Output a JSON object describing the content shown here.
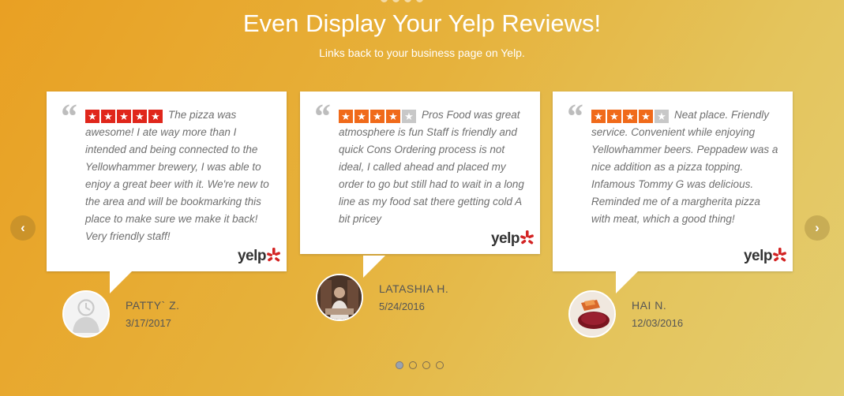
{
  "header": {
    "title": "Even Display Your Yelp Reviews!",
    "subtitle": "Links back to your business page on Yelp."
  },
  "reviews": [
    {
      "rating": 5,
      "star_color": "#e0261b",
      "text": "The pizza was awesome! I ate way more than I intended and being connected to the Yellowhammer brewery, I was able to enjoy a great beer with it. We're new to the area and will be bookmarking this place to make sure we make it back! Very friendly staff!",
      "author": "PATTY` Z.",
      "date": "3/17/2017",
      "avatar": "default-user-icon"
    },
    {
      "rating": 4,
      "star_color": "#f06a1a",
      "text": "Pros Food was great atmosphere is fun Staff is friendly and quick Cons Ordering process is not ideal, I called ahead and placed my order to go but still had to wait in a long line as my food sat there getting cold A bit pricey",
      "author": "LATASHIA H.",
      "date": "5/24/2016",
      "avatar": "user-photo"
    },
    {
      "rating": 4,
      "star_color": "#f06a1a",
      "text": "Neat place. Friendly service. Convenient while enjoying Yellowhammer beers. Peppadew was a nice addition as a pizza topping. Infamous Tommy G was delicious. Reminded me of a margherita pizza with meat, which a good thing!",
      "author": "HAI N.",
      "date": "12/03/2016",
      "avatar": "food-photo"
    }
  ],
  "brand": {
    "yelp_label": "yelp",
    "yelp_burst_color": "#d32323"
  },
  "carousel": {
    "prev_icon": "chevron-left-icon",
    "next_icon": "chevron-right-icon",
    "page_count": 4,
    "active_page": 1
  }
}
